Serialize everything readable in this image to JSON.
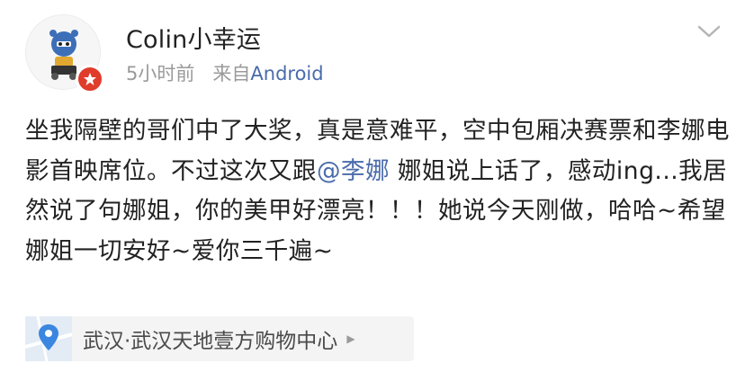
{
  "user": {
    "name": "Colin小幸运",
    "time": "5小时前",
    "source_prefix": "来自",
    "source": "Android"
  },
  "post": {
    "text_before_mention": "坐我隔壁的哥们中了大奖，真是意难平，空中包厢决赛票和李娜电影首映席位。不过这次又跟",
    "mention": "@李娜",
    "text_after_mention": " 娜姐说上话了，感动ing...我居然说了句娜姐，你的美甲好漂亮！！！她说今天刚做，哈哈~希望娜姐一切安好~爱你三千遍~"
  },
  "location": {
    "label": "武汉·武汉天地壹方购物中心"
  },
  "icons": {
    "avatar": "cartoon-robot-avatar",
    "badge": "vip-star-badge",
    "menu": "chevron-down-icon",
    "location": "map-pin-icon",
    "location_arrow": "triangle-right-icon"
  },
  "colors": {
    "link": "#4a6bab",
    "badge": "#e03c2b",
    "text": "#222222",
    "meta": "#9a9a9a"
  }
}
